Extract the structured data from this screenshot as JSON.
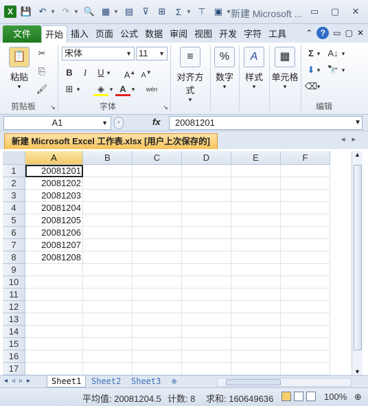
{
  "titlebar": {
    "title": "新建 Microsoft ..."
  },
  "ribbon_tabs": [
    "文件",
    "开始",
    "插入",
    "页面",
    "公式",
    "数据",
    "审阅",
    "视图",
    "开发",
    "字符",
    "工具"
  ],
  "ribbon": {
    "paste": "粘贴",
    "clipboard": "剪贴板",
    "font_name": "宋体",
    "font_size": "11",
    "font_group": "字体",
    "align": "对齐方式",
    "number": "数字",
    "style": "样式",
    "cells": "单元格",
    "edit": "编辑",
    "percent": "%"
  },
  "formula_bar": {
    "name_box": "A1",
    "fx": "fx",
    "value": "20081201"
  },
  "workbook_tab": "新建 Microsoft Excel 工作表.xlsx [用户上次保存的]",
  "columns": [
    "A",
    "B",
    "C",
    "D",
    "E",
    "F"
  ],
  "rows": [
    "1",
    "2",
    "3",
    "4",
    "5",
    "6",
    "7",
    "8",
    "9",
    "10",
    "11",
    "12",
    "13",
    "14",
    "15",
    "16",
    "17"
  ],
  "cells_A": [
    "20081201",
    "20081202",
    "20081203",
    "20081204",
    "20081205",
    "20081206",
    "20081207",
    "20081208"
  ],
  "sheets": [
    "Sheet1",
    "Sheet2",
    "Sheet3"
  ],
  "status": {
    "average": "平均值: 20081204.5",
    "count": "计数: 8",
    "sum": "求和: 160649636",
    "zoom": "100%"
  }
}
